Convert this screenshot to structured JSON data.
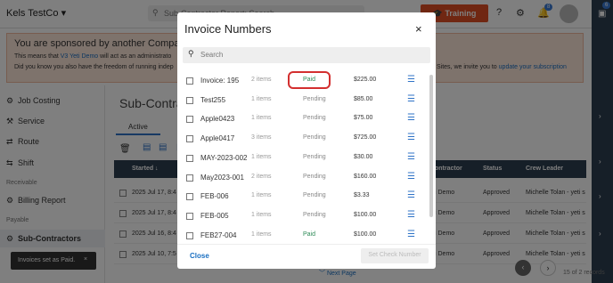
{
  "topbar": {
    "company": "Kels TestCo",
    "search_placeholder": "Sub-Contractor Report: Search",
    "training_label": "Training",
    "notif_count": "8",
    "right_count": "6"
  },
  "sponsor": {
    "heading": "You are sponsored by another Compa",
    "line1a": "This means that ",
    "line1_link": "V3 Yeti Demo",
    "line1b": " will act as an administrato",
    "line2": "Did you know you also have the freedom of running indep",
    "line2_right": "Sites, we invite you to ",
    "upgrade_link": "update your subscription"
  },
  "sidebar": {
    "job_costing": "Job Costing",
    "service": "Service",
    "route": "Route",
    "shift": "Shift",
    "receivable": "Receivable",
    "billing_report": "Billing Report",
    "payable": "Payable",
    "subcontractors": "Sub-Contractors"
  },
  "main": {
    "subtitle": "Sub-Contract",
    "tab_active": "Active",
    "headers": {
      "started": "Started",
      "contractor": "ontractor",
      "status": "Status",
      "crew": "Crew Leader"
    },
    "rows": [
      {
        "started": "2025 Jul 17, 8:4",
        "contractor": "i Demo",
        "status": "Approved",
        "crew": "Michelle Tolan - yeti s"
      },
      {
        "started": "2025 Jul 17, 8:4",
        "contractor": "i Demo",
        "status": "Approved",
        "crew": "Michelle Tolan - yeti s"
      },
      {
        "started": "2025 Jul 16, 8:4",
        "contractor": "i Demo",
        "status": "Approved",
        "crew": "Michelle Tolan - yeti s"
      },
      {
        "started": "2025 Jul 10, 7:5",
        "contractor": "i Demo",
        "status": "Approved",
        "crew": "Michelle Tolan - yeti s"
      }
    ],
    "next_page": "Next Page",
    "page_info": "15 of 2 records"
  },
  "toast": {
    "message": "Invoices set as Paid.",
    "close": "×"
  },
  "modal": {
    "title": "Invoice Numbers",
    "close_icon": "×",
    "search_placeholder": "Search",
    "items": [
      {
        "name": "Invoice: 195",
        "items": "2 items",
        "status": "Paid",
        "amount": "$225.00"
      },
      {
        "name": "Test255",
        "items": "1 items",
        "status": "Pending",
        "amount": "$85.00"
      },
      {
        "name": "Apple0423",
        "items": "1 items",
        "status": "Pending",
        "amount": "$75.00"
      },
      {
        "name": "Apple0417",
        "items": "3 items",
        "status": "Pending",
        "amount": "$725.00"
      },
      {
        "name": "MAY-2023-002",
        "items": "1 items",
        "status": "Pending",
        "amount": "$30.00"
      },
      {
        "name": "May2023-001",
        "items": "2 items",
        "status": "Pending",
        "amount": "$160.00"
      },
      {
        "name": "FEB-006",
        "items": "1 items",
        "status": "Pending",
        "amount": "$3.33"
      },
      {
        "name": "FEB-005",
        "items": "1 items",
        "status": "Pending",
        "amount": "$100.00"
      },
      {
        "name": "FEB27-004",
        "items": "1 items",
        "status": "Paid",
        "amount": "$100.00"
      }
    ],
    "close_label": "Close",
    "set_check_label": "Set Check Number"
  },
  "colors": {
    "accent": "#2f73c7",
    "paid": "#2e8b57",
    "pending": "#888888",
    "training": "#e04f24",
    "ring": "#d32f2f"
  }
}
